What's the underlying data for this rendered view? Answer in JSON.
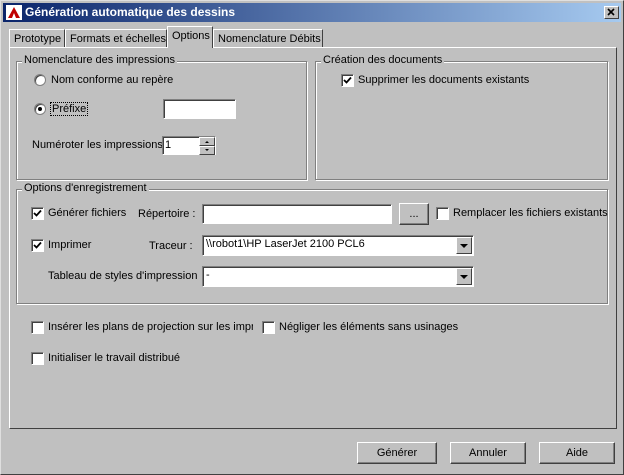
{
  "window": {
    "title": "Génération automatique des dessins"
  },
  "tabs": [
    {
      "label": "Prototype"
    },
    {
      "label": "Formats et échelles"
    },
    {
      "label": "Options"
    },
    {
      "label": "Nomenclature Débits"
    }
  ],
  "nomenclature": {
    "legend": "Nomenclature des impressions",
    "radio_name_label": "Nom conforme au repère",
    "radio_prefix_label": "Préfixe",
    "prefix_value": "",
    "number_label": "Numéroter les impressions",
    "number_value": "1"
  },
  "creation": {
    "legend": "Création des documents",
    "delete_label": "Supprimer les documents existants"
  },
  "save_options": {
    "legend": "Options d'enregistrement",
    "generate_files_label": "Générer fichiers",
    "directory_label": "Répertoire :",
    "directory_value": "",
    "browse_label": "...",
    "replace_label": "Remplacer les fichiers existants",
    "print_label": "Imprimer",
    "plotter_label": "Traceur :",
    "plotter_value": "\\\\robot1\\HP LaserJet 2100 PCL6",
    "styles_label": "Tableau de styles d'impression",
    "styles_value": "-"
  },
  "extra": {
    "insert_label": "Insérer les plans de projection sur les impres",
    "ignore_label": "Négliger les éléments sans usinages",
    "init_label": "Initialiser le travail distribué"
  },
  "buttons": {
    "generate": "Générer",
    "cancel": "Annuler",
    "help": "Aide"
  },
  "colors": {
    "title_start": "#0a246a",
    "title_end": "#a6caf0",
    "face": "#c0c0c0"
  }
}
